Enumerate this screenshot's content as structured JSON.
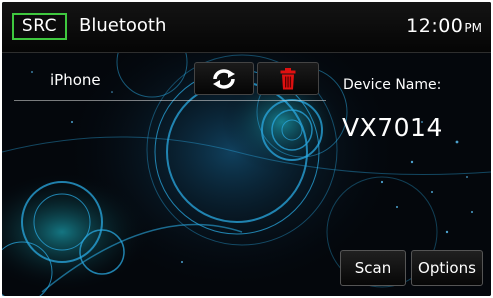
{
  "header": {
    "src_label": "SRC",
    "source_title": "Bluetooth",
    "clock_time": "12:00",
    "clock_ampm": "PM"
  },
  "paired_device": {
    "label": "iPhone",
    "connect_icon": "connect-icon",
    "delete_icon": "trash-icon"
  },
  "device_info": {
    "caption": "Device Name:",
    "value": "VX7014"
  },
  "buttons": {
    "scan": "Scan",
    "options": "Options"
  },
  "colors": {
    "src_border": "#3fc83f",
    "delete_icon": "#e01010",
    "background_glow": "#1fa4d8"
  }
}
